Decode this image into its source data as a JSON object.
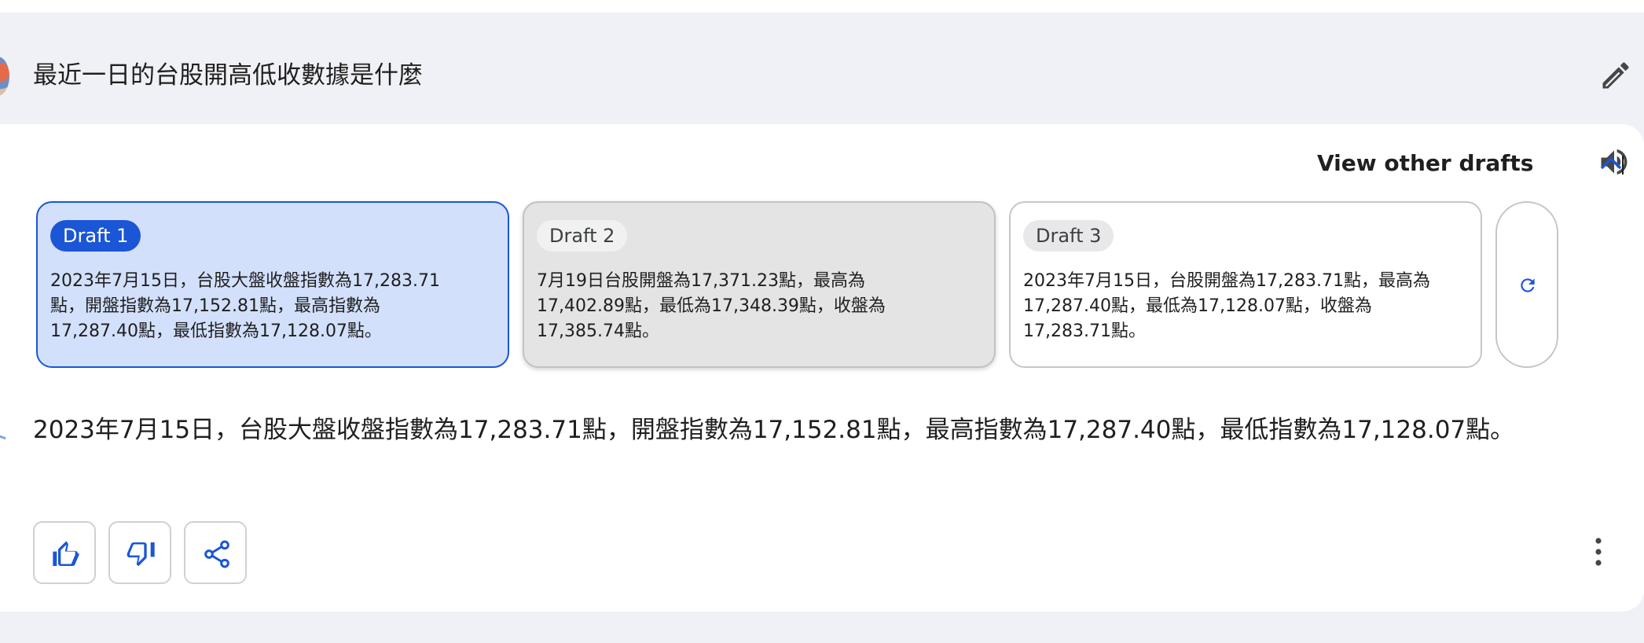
{
  "query": {
    "text": "最近一日的台股開高低收數據是什麼"
  },
  "drafts_header": {
    "label": "View other drafts"
  },
  "drafts": [
    {
      "label": "Draft 1",
      "text": "2023年7月15日，台股大盤收盤指數為17,283.71點，開盤指數為17,152.81點，最高指數為17,287.40點，最低指數為17,128.07點。",
      "state": "selected"
    },
    {
      "label": "Draft 2",
      "text": "7月19日台股開盤為17,371.23點，最高為17,402.89點，最低為17,348.39點，收盤為17,385.74點。",
      "state": "hover"
    },
    {
      "label": "Draft 3",
      "text": "2023年7月15日，台股開盤為17,283.71點，最高為17,287.40點，最低為17,128.07點，收盤為17,283.71點。",
      "state": "default"
    }
  ],
  "answer": {
    "text": "2023年7月15日，台股大盤收盤指數為17,283.71點，開盤指數為17,152.81點，最高指數為17,287.40點，最低指數為17,128.07點。"
  },
  "icons": {
    "edit": "pencil-icon",
    "chevron": "chevron-up-icon",
    "speaker": "speaker-icon",
    "regenerate": "refresh-icon",
    "thumbs_up": "thumbs-up-icon",
    "thumbs_down": "thumbs-down-icon",
    "share": "share-icon",
    "more": "more-vert-icon"
  },
  "colors": {
    "accent": "#1a56d6",
    "selected_bg": "#d3e0fb",
    "page_bg": "#f0f1f6"
  }
}
